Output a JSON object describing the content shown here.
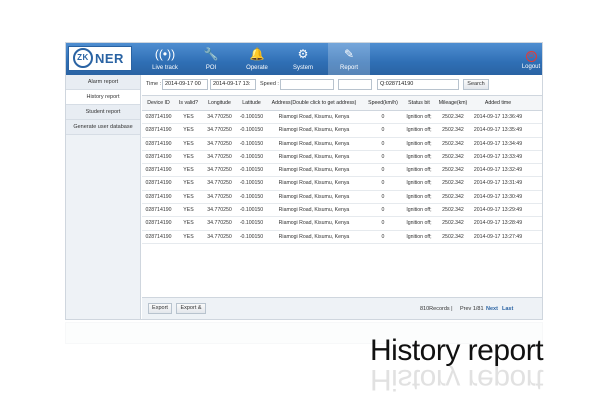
{
  "app": {
    "logo_mark": "ZK",
    "logo_text": "NER"
  },
  "nav": [
    {
      "label": "Live track",
      "icon": "signal-icon",
      "glyph": "((•))"
    },
    {
      "label": "POI",
      "icon": "wrench-icon",
      "glyph": "🔧"
    },
    {
      "label": "Operate",
      "icon": "bell-icon",
      "glyph": "🔔"
    },
    {
      "label": "System",
      "icon": "gear-icon",
      "glyph": "⚙"
    },
    {
      "label": "Report",
      "icon": "report-icon",
      "glyph": "✎",
      "active": true
    }
  ],
  "logout": {
    "label": "Logout",
    "icon": "power-icon",
    "glyph": "⏻"
  },
  "sidebar": [
    {
      "label": "Alarm report"
    },
    {
      "label": "History report",
      "active": true
    },
    {
      "label": "Student report"
    },
    {
      "label": "Generate user database"
    }
  ],
  "search": {
    "time_label": "Time :",
    "time_from": "2014-09-17 00",
    "time_to": "2014-09-17 13:",
    "speed_label": "Speed :",
    "speed_value": "",
    "device_value": "Q:028714190",
    "search_button": "Search"
  },
  "table": {
    "headers": [
      "Device ID",
      "Is valid?",
      "Longitude",
      "Latitude",
      "Address(Double click to get address)",
      "Speed(km/h)",
      "Status bit",
      "Mileage(km)",
      "Added time"
    ],
    "rows": [
      [
        "028714190",
        "YES",
        "34.770250",
        "-0.100150",
        "Riamogi Road, Kisumu, Kenya",
        "0",
        "Ignition off;",
        "2502.342",
        "2014-09-17 13:36:49"
      ],
      [
        "028714190",
        "YES",
        "34.770250",
        "-0.100150",
        "Riamogi Road, Kisumu, Kenya",
        "0",
        "Ignition off;",
        "2502.342",
        "2014-09-17 13:35:49"
      ],
      [
        "028714190",
        "YES",
        "34.770250",
        "-0.100150",
        "Riamogi Road, Kisumu, Kenya",
        "0",
        "Ignition off;",
        "2502.342",
        "2014-09-17 13:34:49"
      ],
      [
        "028714190",
        "YES",
        "34.770250",
        "-0.100150",
        "Riamogi Road, Kisumu, Kenya",
        "0",
        "Ignition off;",
        "2502.342",
        "2014-09-17 13:33:49"
      ],
      [
        "028714190",
        "YES",
        "34.770250",
        "-0.100150",
        "Riamogi Road, Kisumu, Kenya",
        "0",
        "Ignition off;",
        "2502.342",
        "2014-09-17 13:32:49"
      ],
      [
        "028714190",
        "YES",
        "34.770250",
        "-0.100150",
        "Riamogi Road, Kisumu, Kenya",
        "0",
        "Ignition off;",
        "2502.342",
        "2014-09-17 13:31:49"
      ],
      [
        "028714190",
        "YES",
        "34.770250",
        "-0.100150",
        "Riamogi Road, Kisumu, Kenya",
        "0",
        "Ignition off;",
        "2502.342",
        "2014-09-17 13:30:49"
      ],
      [
        "028714190",
        "YES",
        "34.770250",
        "-0.100150",
        "Riamogi Road, Kisumu, Kenya",
        "0",
        "Ignition off;",
        "2502.342",
        "2014-09-17 13:29:49"
      ],
      [
        "028714190",
        "YES",
        "34.770250",
        "-0.100150",
        "Riamogi Road, Kisumu, Kenya",
        "0",
        "Ignition off;",
        "2502.342",
        "2014-09-17 13:28:49"
      ],
      [
        "028714190",
        "YES",
        "34.770250",
        "-0.100150",
        "Riamogi Road, Kisumu, Kenya",
        "0",
        "Ignition off;",
        "2502.342",
        "2014-09-17 13:27:49"
      ]
    ]
  },
  "footer": {
    "export_button": "Export",
    "export_all_button": "Export &",
    "records": "810Records |",
    "page": "Prev 1/81",
    "next": "Next",
    "last": "Last"
  },
  "caption": "History report",
  "colors": {
    "header_blue": "#2f6fb5",
    "accent_red": "#e53935",
    "link_blue": "#2a63a3"
  }
}
